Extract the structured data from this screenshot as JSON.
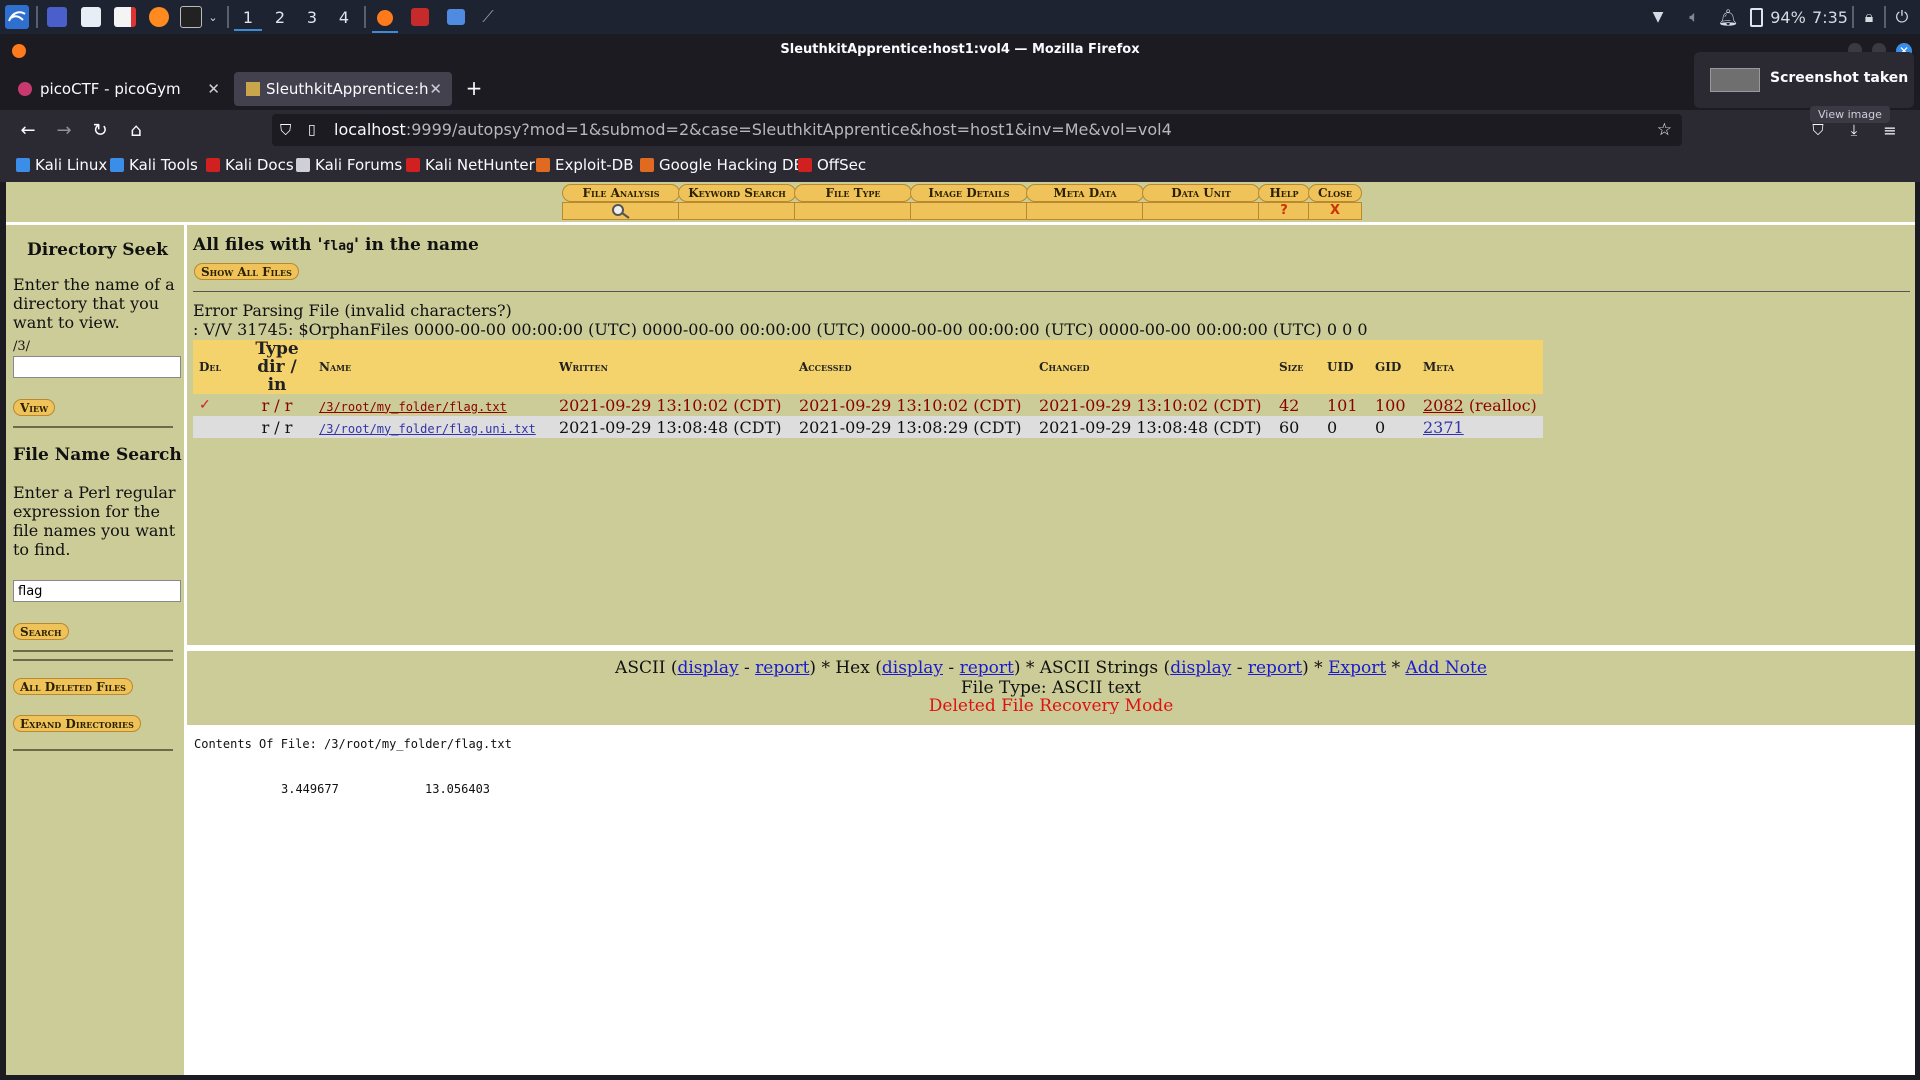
{
  "taskbar": {
    "workspaces": [
      "1",
      "2",
      "3",
      "4"
    ],
    "battery": "94%",
    "clock": "7:35"
  },
  "window": {
    "title": "SleuthkitApprentice:host1:vol4 — Mozilla Firefox"
  },
  "tabs": [
    {
      "label": "picoCTF - picoGym"
    },
    {
      "label": "SleuthkitApprentice:host1"
    }
  ],
  "url": {
    "host": "localhost",
    "path": ":9999/autopsy?mod=1&submod=2&case=SleuthkitApprentice&host=host1&inv=Me&vol=vol4"
  },
  "bookmarks": [
    {
      "label": "Kali Linux",
      "color": "#3b8ee8"
    },
    {
      "label": "Kali Tools",
      "color": "#3b8ee8"
    },
    {
      "label": "Kali Docs",
      "color": "#d02020"
    },
    {
      "label": "Kali Forums",
      "color": "#cfcfd8"
    },
    {
      "label": "Kali NetHunter",
      "color": "#d02020"
    },
    {
      "label": "Exploit-DB",
      "color": "#e06a20"
    },
    {
      "label": "Google Hacking DB",
      "color": "#e06a20"
    },
    {
      "label": "OffSec",
      "color": "#d02020"
    }
  ],
  "toast": {
    "title": "Screenshot taken",
    "action": "View image"
  },
  "menu": {
    "file_analysis": "File Analysis",
    "keyword_search": "Keyword Search",
    "file_type": "File Type",
    "image_details": "Image Details",
    "meta_data": "Meta Data",
    "data_unit": "Data Unit",
    "help": "Help",
    "help_mark": "?",
    "close": "Close",
    "close_mark": "X"
  },
  "left": {
    "dir_heading": "Directory Seek",
    "dir_help": "Enter the name of a directory that you want to view.",
    "dir_prefix": "/3/",
    "dir_value": "",
    "view_btn": "View",
    "fn_heading": "File Name Search",
    "fn_help": "Enter a Perl regular expression for the file names you want to find.",
    "fn_value": "flag",
    "search_btn": "Search",
    "deleted_btn": "All Deleted Files",
    "expand_btn": "Expand Directories"
  },
  "main": {
    "title_pre": "All files with '",
    "title_term": "flag",
    "title_post": "' in the name",
    "show_all": "Show All Files",
    "error1": "Error Parsing File (invalid characters?)",
    "error2": ": V/V 31745: $OrphanFiles 0000-00-00 00:00:00 (UTC) 0000-00-00 00:00:00 (UTC) 0000-00-00 00:00:00 (UTC) 0000-00-00 00:00:00 (UTC) 0 0 0",
    "headers": {
      "del": "Del",
      "type": "Type dir / in",
      "name": "Name",
      "written": "Written",
      "accessed": "Accessed",
      "changed": "Changed",
      "size": "Size",
      "uid": "UID",
      "gid": "GID",
      "meta": "Meta"
    },
    "rows": [
      {
        "del": "✓",
        "type": "r / r",
        "name": "/3/root/my_folder/flag.txt",
        "written": "2021-09-29 13:10:02 (CDT)",
        "accessed": "2021-09-29 13:10:02 (CDT)",
        "changed": "2021-09-29 13:10:02 (CDT)",
        "size": "42",
        "uid": "101",
        "gid": "100",
        "meta": "2082",
        "meta_note": "(realloc)"
      },
      {
        "del": "",
        "type": "r / r",
        "name": "/3/root/my_folder/flag.uni.txt",
        "written": "2021-09-29 13:08:48 (CDT)",
        "accessed": "2021-09-29 13:08:29 (CDT)",
        "changed": "2021-09-29 13:08:48 (CDT)",
        "size": "60",
        "uid": "0",
        "gid": "0",
        "meta": "2371",
        "meta_note": ""
      }
    ]
  },
  "fileinfo": {
    "ascii": "ASCII",
    "hex": "Hex",
    "strings": "ASCII Strings",
    "display": "display",
    "report": "report",
    "export": "Export",
    "add_note": "Add Note",
    "file_type": "File Type: ASCII text",
    "recovery": "Deleted File Recovery Mode"
  },
  "contents": {
    "header": "Contents Of File: /3/root/my_folder/flag.txt",
    "v1": "3.449677",
    "v2": "13.056403"
  }
}
